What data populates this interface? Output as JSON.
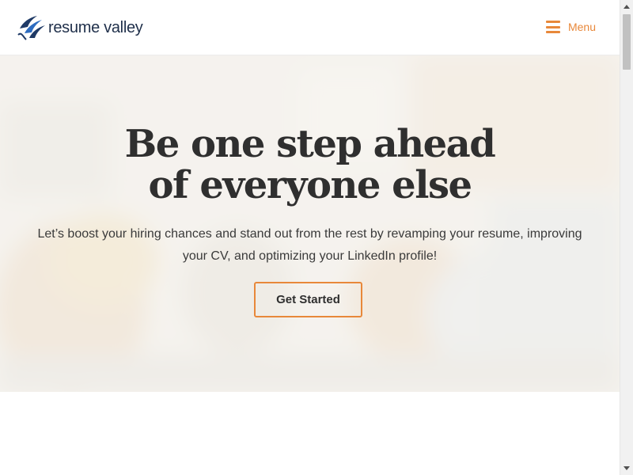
{
  "header": {
    "logo_text": "resume valley",
    "menu_label": "Menu",
    "accent_color": "#e8883a"
  },
  "hero": {
    "title_line1": "Be one step ahead",
    "title_line2": "of everyone else",
    "subtitle": "Let’s boost your hiring chances and stand out from the rest by revamping your resume, improving your CV, and optimizing your LinkedIn profile!",
    "cta_label": "Get Started"
  },
  "icons": {
    "logo": "resume-valley-logo-icon",
    "menu": "hamburger-icon",
    "scroll_up": "scroll-up-arrow-icon",
    "scroll_down": "scroll-down-arrow-icon"
  },
  "colors": {
    "accent": "#e8883a",
    "logo_blue": "#1f4e8c",
    "heading": "#2f2f2f"
  }
}
